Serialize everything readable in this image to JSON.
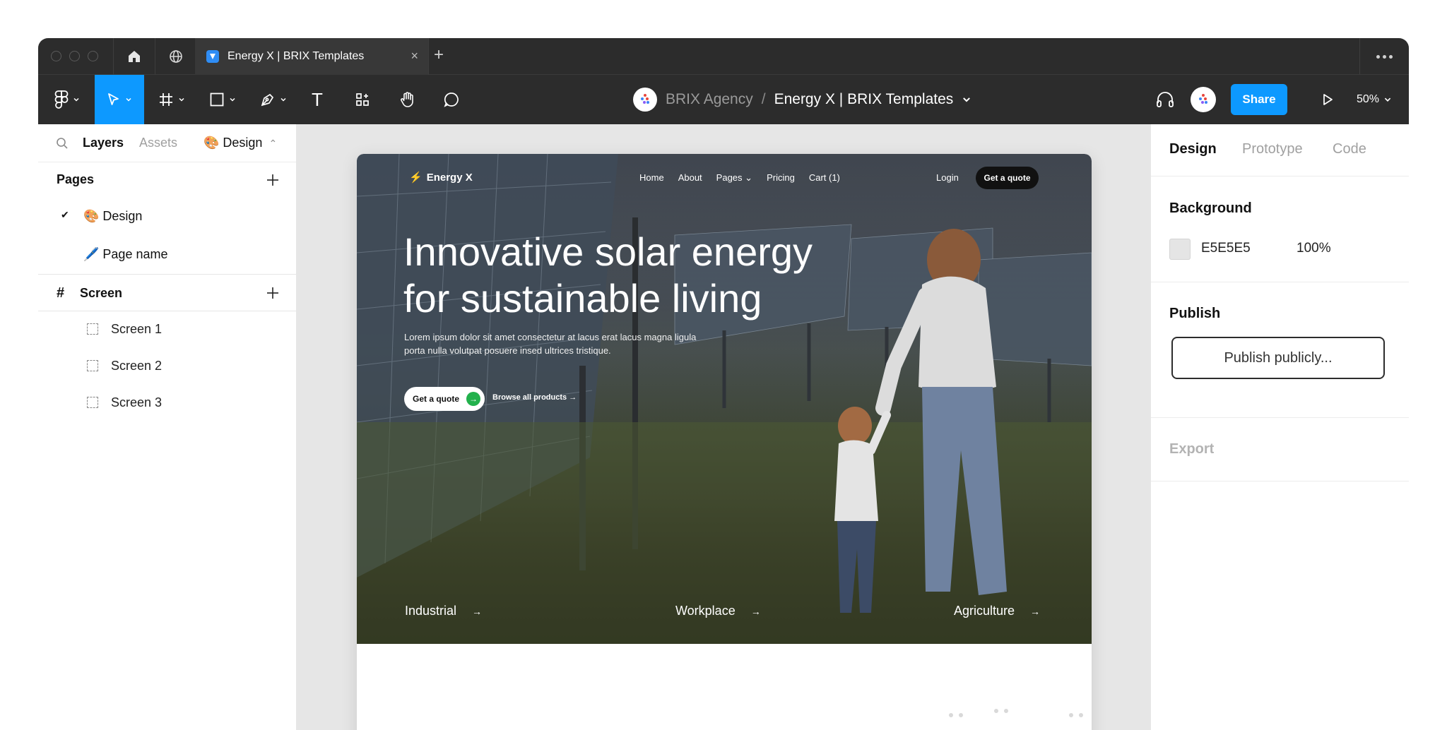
{
  "tabbar": {
    "file_tab_title": "Energy X | BRIX Templates",
    "close_glyph": "×",
    "new_tab_glyph": "+"
  },
  "toolbar": {
    "team_name": "BRIX Agency",
    "separator": "/",
    "file_name": "Energy X | BRIX Templates",
    "share_label": "Share",
    "zoom_level": "50%",
    "text_tool_glyph": "T"
  },
  "left_panel": {
    "tabs": {
      "layers": "Layers",
      "assets": "Assets",
      "design": "🎨 Design",
      "design_caret": "⌃"
    },
    "pages_title": "Pages",
    "pages": [
      {
        "label": "🎨 Design",
        "check": "✔"
      },
      {
        "label": "🖊️ Page name"
      }
    ],
    "screen_section": {
      "hash": "#",
      "label": "Screen"
    },
    "layers": [
      "Screen 1",
      "Screen 2",
      "Screen 3"
    ]
  },
  "right_panel": {
    "tabs": {
      "design": "Design",
      "prototype": "Prototype",
      "code": "Code"
    },
    "background": {
      "title": "Background",
      "hex": "E5E5E5",
      "opacity": "100%",
      "swatch_color": "#E5E5E5"
    },
    "publish": {
      "title": "Publish",
      "button": "Publish publicly..."
    },
    "export": {
      "title": "Export"
    }
  },
  "site": {
    "logo": "Energy X",
    "logo_glyph": "⚡",
    "nav_links": [
      "Home",
      "About",
      "Pages",
      "Pricing",
      "Cart (1)"
    ],
    "nav_pages_caret": "⌄",
    "login": "Login",
    "quote_button": "Get a quote",
    "headline": "Innovative solar energy for sustainable living",
    "subtext": "Lorem ipsum dolor sit amet consectetur at lacus erat lacus magna ligula porta nulla volutpat posuere insed ultrices tristique.",
    "cta_primary": "Get a quote",
    "cta_primary_arrow": "→",
    "cta_secondary": "Browse all products →",
    "categories": [
      "Industrial",
      "Workplace",
      "Agriculture"
    ],
    "category_arrow": "→"
  },
  "colors": {
    "accent": "#0D99FF",
    "toolbar_bg": "#2C2C2C",
    "canvas_bg": "#E6E6E6",
    "cta_green": "#22B14C"
  },
  "icons": {
    "tabbar": [
      "home-icon",
      "globe-icon",
      "more-icon"
    ],
    "toolbar": [
      "figma-menu-icon",
      "move-tool-icon",
      "frame-tool-icon",
      "shape-tool-icon",
      "pen-tool-icon",
      "text-tool-icon",
      "resources-icon",
      "hand-tool-icon",
      "comment-icon",
      "headphones-icon",
      "present-icon"
    ]
  }
}
